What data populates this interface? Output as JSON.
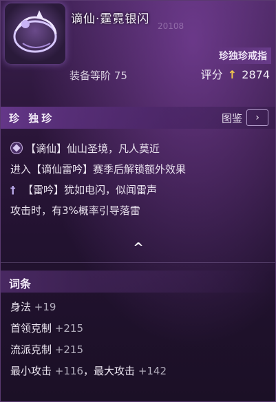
{
  "item": {
    "name": "谪仙·霆霓银闪",
    "bg_code": "20108",
    "rarity_badge": "珍独珍戒指",
    "equip_level_label": "装备等阶",
    "equip_level_value": "75",
    "score_label": "评分",
    "score_value": "2874"
  },
  "rarity_bar": {
    "title": "珍 独珍",
    "atlas_label": "图鉴",
    "atlas_arrow": "›"
  },
  "effects": [
    "【谪仙】仙山圣境，凡人莫近",
    "进入【谪仙雷吟】赛季后解锁额外效果",
    "【雷吟】犹如电闪，似闻雷声",
    "攻击时，有3%概率引导落雷"
  ],
  "collapse_glyph": "^",
  "affix": {
    "title": "词条",
    "rows": [
      {
        "name": "身法",
        "value": "+19"
      },
      {
        "name": "首领克制",
        "value": "+215"
      },
      {
        "name": "流派克制",
        "value": "+215"
      },
      {
        "name": "最小攻击",
        "value": "+116",
        "name2": "最大攻击",
        "value2": "+142"
      }
    ]
  },
  "colors": {
    "accent": "#f2c94c",
    "panel": "#2a1538",
    "rarity": "#6e3c96"
  },
  "icons": [
    "ring-item-icon",
    "gem-icon",
    "cross-icon",
    "arrow-up-icon",
    "chevron-right-icon",
    "chevron-up-icon"
  ]
}
